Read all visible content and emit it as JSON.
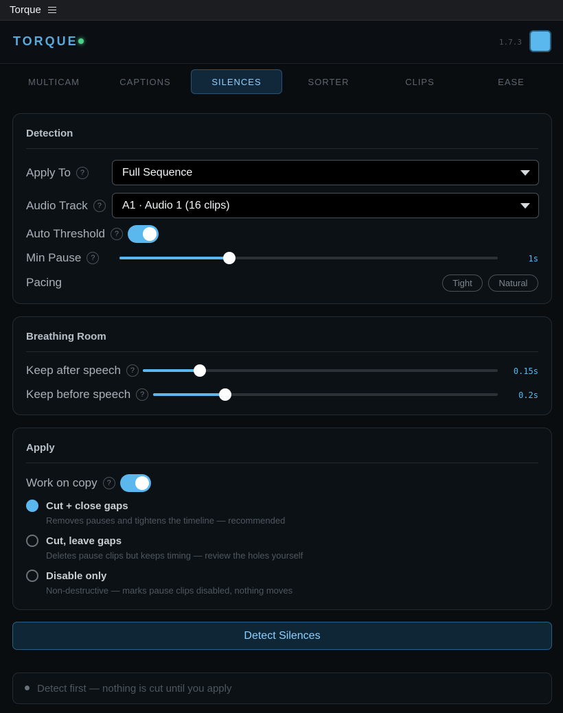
{
  "window": {
    "title": "Torque",
    "menu_icon": "hamburger-icon"
  },
  "header": {
    "brand": "TORQUE",
    "status_color": "#4fd08a",
    "version": "1.7.3",
    "swatch_color": "#5ab8ef"
  },
  "tabs": [
    {
      "label": "MULTICAM",
      "active": false
    },
    {
      "label": "CAPTIONS",
      "active": false
    },
    {
      "label": "SILENCES",
      "active": true
    },
    {
      "label": "SORTER",
      "active": false
    },
    {
      "label": "CLIPS",
      "active": false
    },
    {
      "label": "EASE",
      "active": false
    }
  ],
  "detection": {
    "title": "Detection",
    "apply_to": {
      "label": "Apply To",
      "value": "Full Sequence"
    },
    "audio_track": {
      "label": "Audio Track",
      "value": "A1 · Audio 1 (16 clips)"
    },
    "auto_threshold": {
      "label": "Auto Threshold",
      "on": true
    },
    "min_pause": {
      "label": "Min Pause",
      "value": "1s",
      "fraction": 0.29
    },
    "pacing": {
      "label": "Pacing",
      "options": [
        "Tight",
        "Natural"
      ]
    }
  },
  "breathing_room": {
    "title": "Breathing Room",
    "keep_after": {
      "label": "Keep after speech",
      "value": "0.15s",
      "fraction": 0.16
    },
    "keep_before": {
      "label": "Keep before speech",
      "value": "0.2s",
      "fraction": 0.21
    }
  },
  "apply": {
    "title": "Apply",
    "work_on_copy": {
      "label": "Work on copy",
      "on": true
    },
    "modes": [
      {
        "title": "Cut + close gaps",
        "desc": "Removes pauses and tightens the timeline — recommended",
        "checked": true
      },
      {
        "title": "Cut, leave gaps",
        "desc": "Deletes pause clips but keeps timing — review the holes yourself",
        "checked": false
      },
      {
        "title": "Disable only",
        "desc": "Non-destructive — marks pause clips disabled, nothing moves",
        "checked": false
      }
    ]
  },
  "action": {
    "detect_label": "Detect Silences"
  },
  "status": {
    "text": "Detect first — nothing is cut until you apply"
  },
  "colors": {
    "accent": "#5ab8ef",
    "background": "#0a0d10"
  }
}
